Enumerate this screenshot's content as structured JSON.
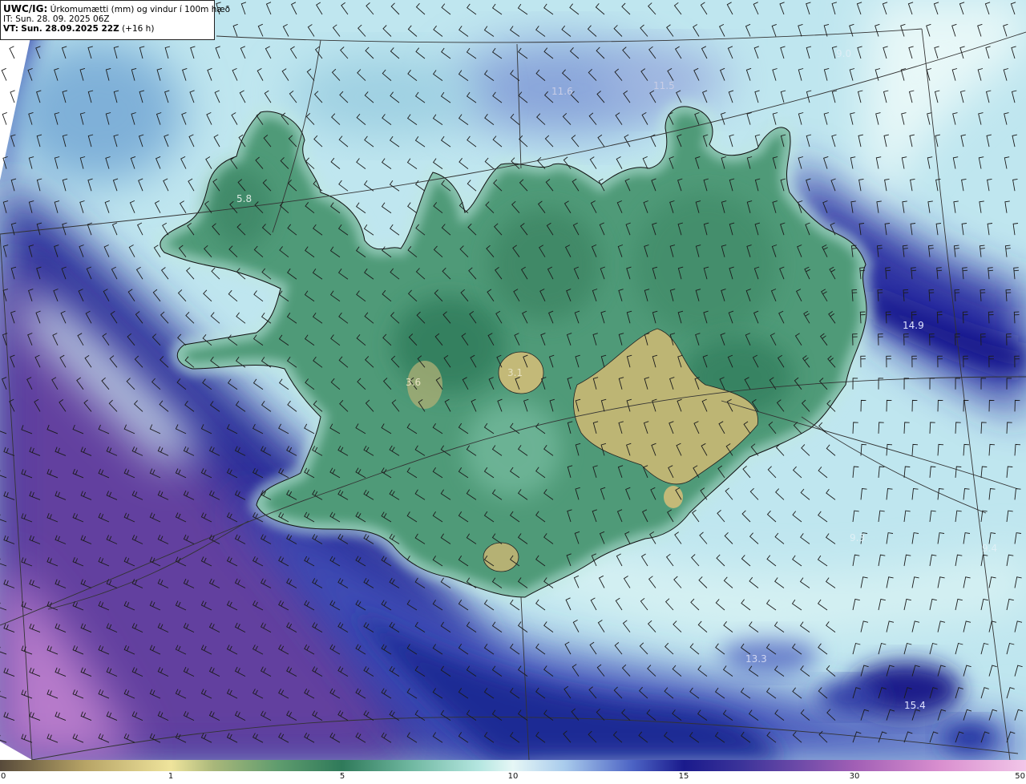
{
  "header": {
    "model": "UWC/IG:",
    "title": "Úrkomumætti (mm) og vindur í 100m hæð",
    "init_label": "IT:",
    "init_time": "Sun. 28. 09. 2025 06Z",
    "valid_label": "VT:",
    "valid_time": "Sun. 28.09.2025 22Z",
    "lead": "(+16 h)"
  },
  "map_labels": [
    {
      "text": "11.6",
      "color": "#c8cde6"
    },
    {
      "text": "11.5",
      "color": "#c8cde6"
    },
    {
      "text": "9.0",
      "color": "#ddeef6"
    },
    {
      "text": "5.8",
      "color": "#d9e8e0"
    },
    {
      "text": "3.6",
      "color": "#e6e0c0"
    },
    {
      "text": "3.1",
      "color": "#e6e0c0"
    },
    {
      "text": "14.9",
      "color": "#e0e4ff"
    },
    {
      "text": "13.3",
      "color": "#d0d6f0"
    },
    {
      "text": "15.4",
      "color": "#e0e4ff"
    },
    {
      "text": "9.3",
      "color": "#dff0f6"
    },
    {
      "text": "9.4",
      "color": "#dff0f6"
    }
  ],
  "colorbar": {
    "ticks": [
      "0",
      "1",
      "5",
      "10",
      "15",
      "30",
      "50"
    ],
    "stops": [
      {
        "v": 0,
        "c": "#574a3a"
      },
      {
        "v": 0.5,
        "c": "#b7a466"
      },
      {
        "v": 1,
        "c": "#efe49c"
      },
      {
        "v": 2,
        "c": "#a9b77a"
      },
      {
        "v": 3.5,
        "c": "#5f9c6e"
      },
      {
        "v": 5,
        "c": "#2f7a5a"
      },
      {
        "v": 7,
        "c": "#6fb7a0"
      },
      {
        "v": 9,
        "c": "#b4e6e0"
      },
      {
        "v": 10,
        "c": "#e6f7f6"
      },
      {
        "v": 11.5,
        "c": "#a9cbec"
      },
      {
        "v": 13.5,
        "c": "#4c63c4"
      },
      {
        "v": 15,
        "c": "#1a1a8c"
      },
      {
        "v": 20,
        "c": "#3b3399"
      },
      {
        "v": 25,
        "c": "#6d4aa8"
      },
      {
        "v": 30,
        "c": "#a15fb5"
      },
      {
        "v": 40,
        "c": "#d98fcf"
      },
      {
        "v": 50,
        "c": "#f2c6e8"
      }
    ]
  },
  "colors": {
    "land_green": "#3f8a68",
    "glacier_yellow": "#b9b070",
    "sea_light": "#bfe9ee",
    "sea_dark_blue": "#2a2fa0",
    "sea_purple": "#6b3f9e",
    "barb": "#1b1b1b",
    "coast": "#111111",
    "grid": "#333333"
  }
}
